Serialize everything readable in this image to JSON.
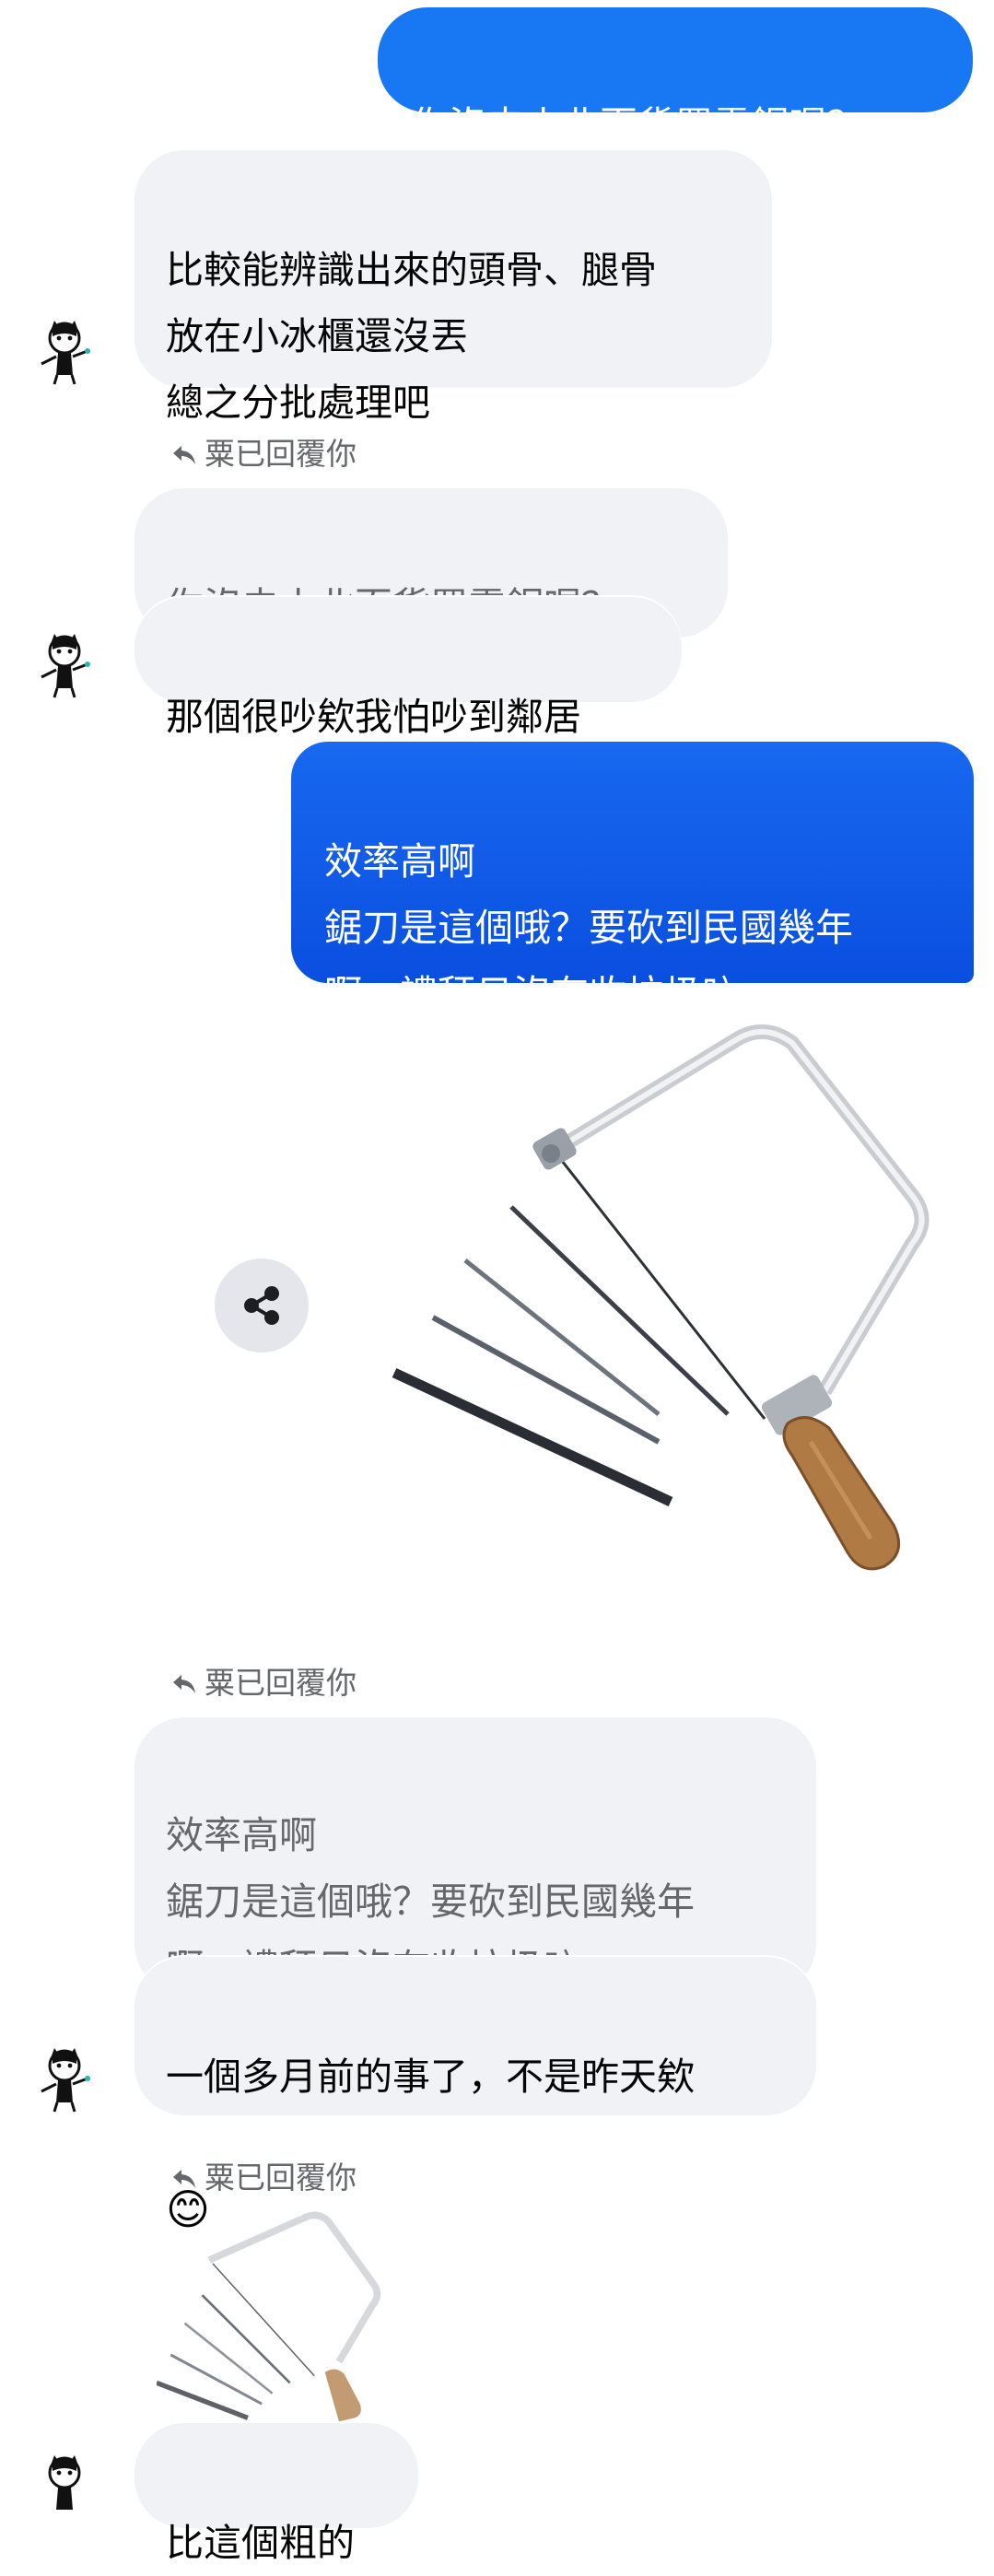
{
  "messages": {
    "m1": {
      "text": "你沒去小北百貨買電鋸喔？"
    },
    "m2": {
      "text": "比較能辨識出來的頭骨、腿骨\n放在小冰櫃還沒丟\n總之分批處理吧"
    },
    "reply1": {
      "label": "粟已回覆你",
      "quoted": "你沒去小北百貨買電鋸喔？",
      "text": "那個很吵欸我怕吵到鄰居"
    },
    "m3": {
      "text": "效率高啊\n鋸刀是這個哦？要砍到民國幾年\n啊，禮拜日沒有收垃圾吶"
    },
    "reply2": {
      "label": "粟已回覆你",
      "quoted": "效率高啊\n鋸刀是這個哦？要砍到民國幾年\n啊，禮拜日沒有收垃圾吶",
      "text": "一個多月前的事了，不是昨天欸",
      "emoji": "😊"
    },
    "reply3": {
      "label": "粟已回覆你",
      "text": "比這個粗的"
    }
  },
  "icons": {
    "share": "share-icon",
    "reply": "reply-arrow-icon"
  },
  "colors": {
    "outgoing_top": "#1877f2",
    "outgoing_bottom": "#0a4fe0",
    "incoming_bg": "#f0f2f5",
    "meta_text": "#65676b"
  }
}
